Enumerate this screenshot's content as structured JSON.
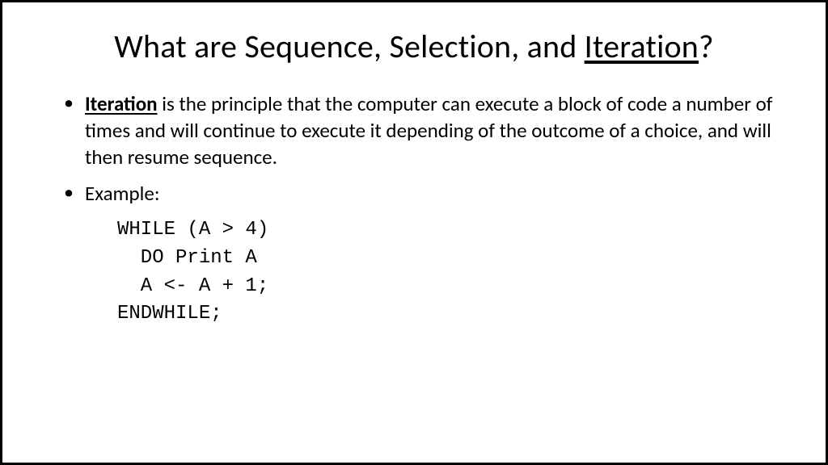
{
  "title": {
    "prefix": "What are Sequence, Selection, and ",
    "underlined": "Iteration",
    "suffix": "?"
  },
  "bullets": {
    "definition": {
      "term": "Iteration",
      "rest": " is the principle that the computer can execute a block of code a number of times and will continue to execute it depending of the outcome of a choice, and will then resume sequence."
    },
    "exampleLabel": "Example:"
  },
  "code": {
    "line1": "WHILE (A > 4)",
    "line2": "  DO Print A",
    "line3": "  A <- A + 1;",
    "line4": "ENDWHILE;"
  }
}
